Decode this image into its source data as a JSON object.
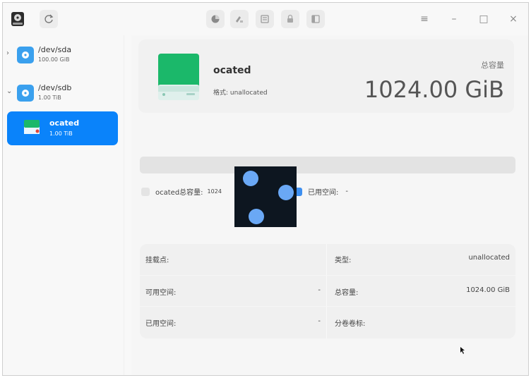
{
  "titlebar": {
    "app_icon": "disk-utility-icon",
    "refresh_icon": "refresh-icon",
    "tools": [
      "partition-icon",
      "format-icon",
      "wipe-icon",
      "mount-icon",
      "unmount-icon"
    ],
    "window_buttons": {
      "menu": "≡",
      "minimize": "–",
      "maximize": "□",
      "close": "×"
    }
  },
  "sidebar": {
    "disks": [
      {
        "name": "/dev/sda",
        "size": "100.00 GiB",
        "expanded": false
      },
      {
        "name": "/dev/sdb",
        "size": "1.00 TiB",
        "expanded": true
      }
    ],
    "partition": {
      "name": "ocated",
      "size": "1.00 TiB",
      "selected": true
    }
  },
  "summary": {
    "title": "ocated",
    "format_label": "格式: unallocated",
    "capacity_label": "总容量",
    "capacity_value": "1024.00 GiB"
  },
  "usage": {
    "total_legend": "ocated总容量:",
    "total_value": "1024",
    "used_legend": "已用空间:",
    "used_value": "-"
  },
  "details": {
    "mount_label": "挂载点:",
    "mount_value": "",
    "free_label": "可用空间:",
    "free_value": "-",
    "used_label": "已用空间:",
    "used_value": "-",
    "type_label": "类型:",
    "type_value": "unallocated",
    "total_label": "总容量:",
    "total_value": "1024.00 GiB",
    "volume_label": "分卷卷标:",
    "volume_value": ""
  },
  "colors": {
    "accent": "#0a83fa",
    "disk_icon": "#3aa0ee",
    "partition_green": "#1bb86a"
  }
}
